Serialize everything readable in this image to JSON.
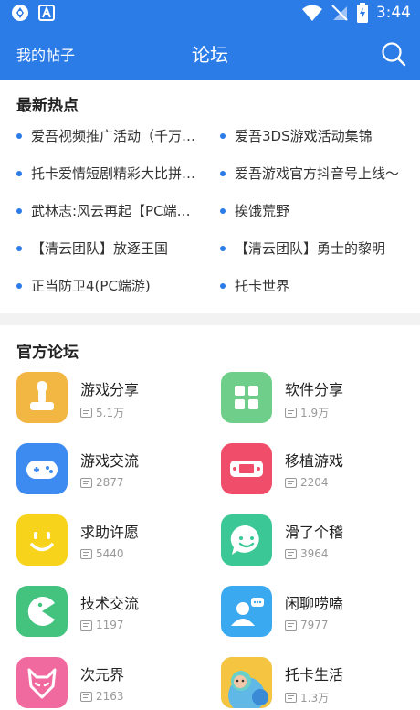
{
  "status_bar": {
    "time": "3:44",
    "icons": [
      "app-icon",
      "a-icon",
      "wifi-icon",
      "no-sim-icon",
      "battery-charging-icon"
    ]
  },
  "header": {
    "my_posts": "我的帖子",
    "title": "论坛",
    "search_icon": "search-icon"
  },
  "hot": {
    "title": "最新热点",
    "items": [
      "爱吾视频推广活动（千万…",
      "爱吾3DS游戏活动集锦",
      "托卡爱情短剧精彩大比拼…",
      "爱吾游戏官方抖音号上线～",
      "武林志:风云再起【PC端…",
      "挨饿荒野",
      "【清云团队】放逐王国",
      "【清云团队】勇士的黎明",
      "正当防卫4(PC端游)",
      "托卡世界"
    ]
  },
  "official": {
    "title": "官方论坛",
    "forums": [
      {
        "name": "游戏分享",
        "count": "5.1万",
        "icon": "joystick-icon",
        "color": "#f2b643"
      },
      {
        "name": "软件分享",
        "count": "1.9万",
        "icon": "grid-icon",
        "color": "#6fce8a"
      },
      {
        "name": "游戏交流",
        "count": "2877",
        "icon": "gamepad-icon",
        "color": "#3d8bf0"
      },
      {
        "name": "移植游戏",
        "count": "2204",
        "icon": "handheld-icon",
        "color": "#f04d6a"
      },
      {
        "name": "求助许愿",
        "count": "5440",
        "icon": "smile-icon",
        "color": "#f8d31c"
      },
      {
        "name": "滑了个稽",
        "count": "3964",
        "icon": "chat-smile-icon",
        "color": "#3cc896"
      },
      {
        "name": "技术交流",
        "count": "1197",
        "icon": "pacman-icon",
        "color": "#44c37f"
      },
      {
        "name": "闲聊唠嗑",
        "count": "7977",
        "icon": "user-chat-icon",
        "color": "#3aa9f0"
      },
      {
        "name": "次元界",
        "count": "2163",
        "icon": "fox-mask-icon",
        "color": "#f06aa0"
      },
      {
        "name": "托卡生活",
        "count": "1.3万",
        "icon": "toca-life-icon",
        "color": "#8fd0e8"
      }
    ]
  }
}
